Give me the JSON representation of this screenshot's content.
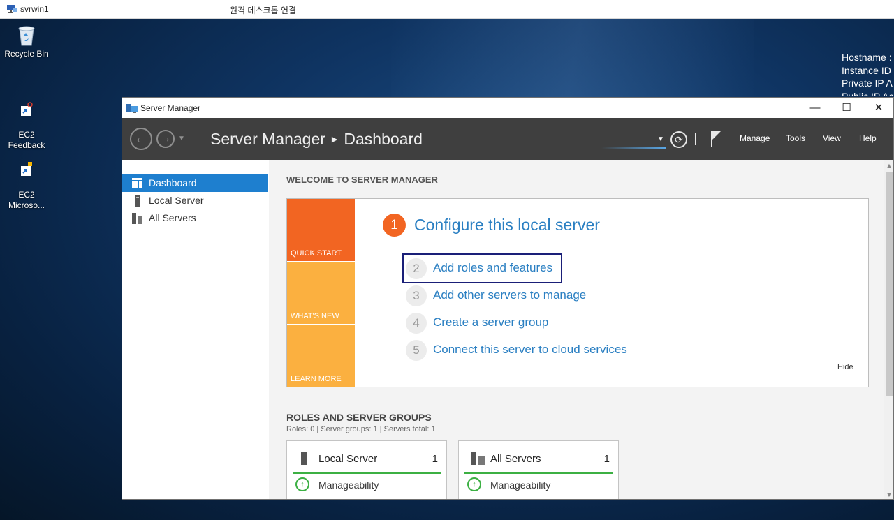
{
  "rdp": {
    "host": "svrwin1",
    "title": "원격 데스크톱 연결"
  },
  "desktop": {
    "icons": [
      {
        "label": "Recycle Bin"
      },
      {
        "label": "EC2\nFeedback"
      },
      {
        "label": "EC2\nMicroso..."
      }
    ],
    "info_lines": [
      "Hostname :",
      "Instance ID",
      "Private IP A",
      "Public IP Ac"
    ]
  },
  "window": {
    "title": "Server Manager",
    "controls": {
      "minimize": "—",
      "maximize": "☐",
      "close": "✕"
    }
  },
  "header": {
    "breadcrumb_app": "Server Manager",
    "breadcrumb_page": "Dashboard",
    "menus": [
      "Manage",
      "Tools",
      "View",
      "Help"
    ]
  },
  "sidebar": {
    "items": [
      {
        "label": "Dashboard",
        "active": true
      },
      {
        "label": "Local Server",
        "active": false
      },
      {
        "label": "All Servers",
        "active": false
      }
    ]
  },
  "welcome": {
    "title": "WELCOME TO SERVER MANAGER",
    "tiles": [
      "QUICK START",
      "WHAT'S NEW",
      "LEARN MORE"
    ],
    "step1": {
      "num": "1",
      "label": "Configure this local server"
    },
    "steps": [
      {
        "num": "2",
        "label": "Add roles and features"
      },
      {
        "num": "3",
        "label": "Add other servers to manage"
      },
      {
        "num": "4",
        "label": "Create a server group"
      },
      {
        "num": "5",
        "label": "Connect this server to cloud services"
      }
    ],
    "hide": "Hide"
  },
  "roles": {
    "title": "ROLES AND SERVER GROUPS",
    "summary": "Roles: 0   |   Server groups: 1   |   Servers total: 1",
    "cards": [
      {
        "name": "Local Server",
        "count": "1",
        "status": "Manageability"
      },
      {
        "name": "All Servers",
        "count": "1",
        "status": "Manageability"
      }
    ]
  },
  "colors": {
    "accent": "#1e7fcf",
    "quick_start": "#f26522",
    "whats_new": "#fbb040",
    "ok": "#3cb043",
    "header_bg": "#3f3f3f"
  }
}
